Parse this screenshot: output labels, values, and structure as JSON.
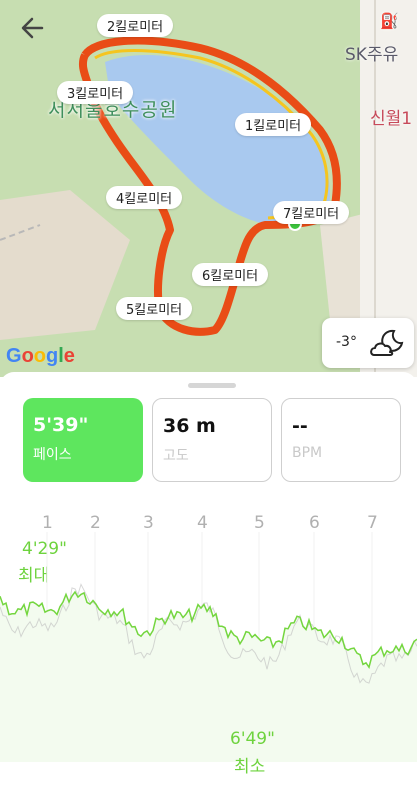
{
  "map": {
    "park_name": "서서울호수공원",
    "poi_gas": "SK주유",
    "poi_station": "신월1",
    "km_labels": [
      "1킬로미터",
      "2킬로미터",
      "3킬로미터",
      "4킬로미터",
      "5킬로미터",
      "6킬로미터",
      "7킬로미터"
    ],
    "weather": {
      "temp": "-3°",
      "icon": "moon-cloud-icon"
    },
    "attribution": "Google"
  },
  "stats": {
    "pace": {
      "value": "5'39\"",
      "label": "페이스"
    },
    "altitude": {
      "value": "36 m",
      "label": "고도"
    },
    "heart_rate": {
      "value": "--",
      "label": "BPM"
    }
  },
  "chart": {
    "km_ticks": [
      "1",
      "2",
      "3",
      "4",
      "5",
      "6",
      "7"
    ],
    "max": {
      "value": "4'29\"",
      "label": "최대"
    },
    "min": {
      "value": "6'49\"",
      "label": "최소"
    },
    "colors": {
      "line": "#74d63f",
      "accent": "#5ee65e",
      "shadow": "#bdbdbd"
    }
  }
}
